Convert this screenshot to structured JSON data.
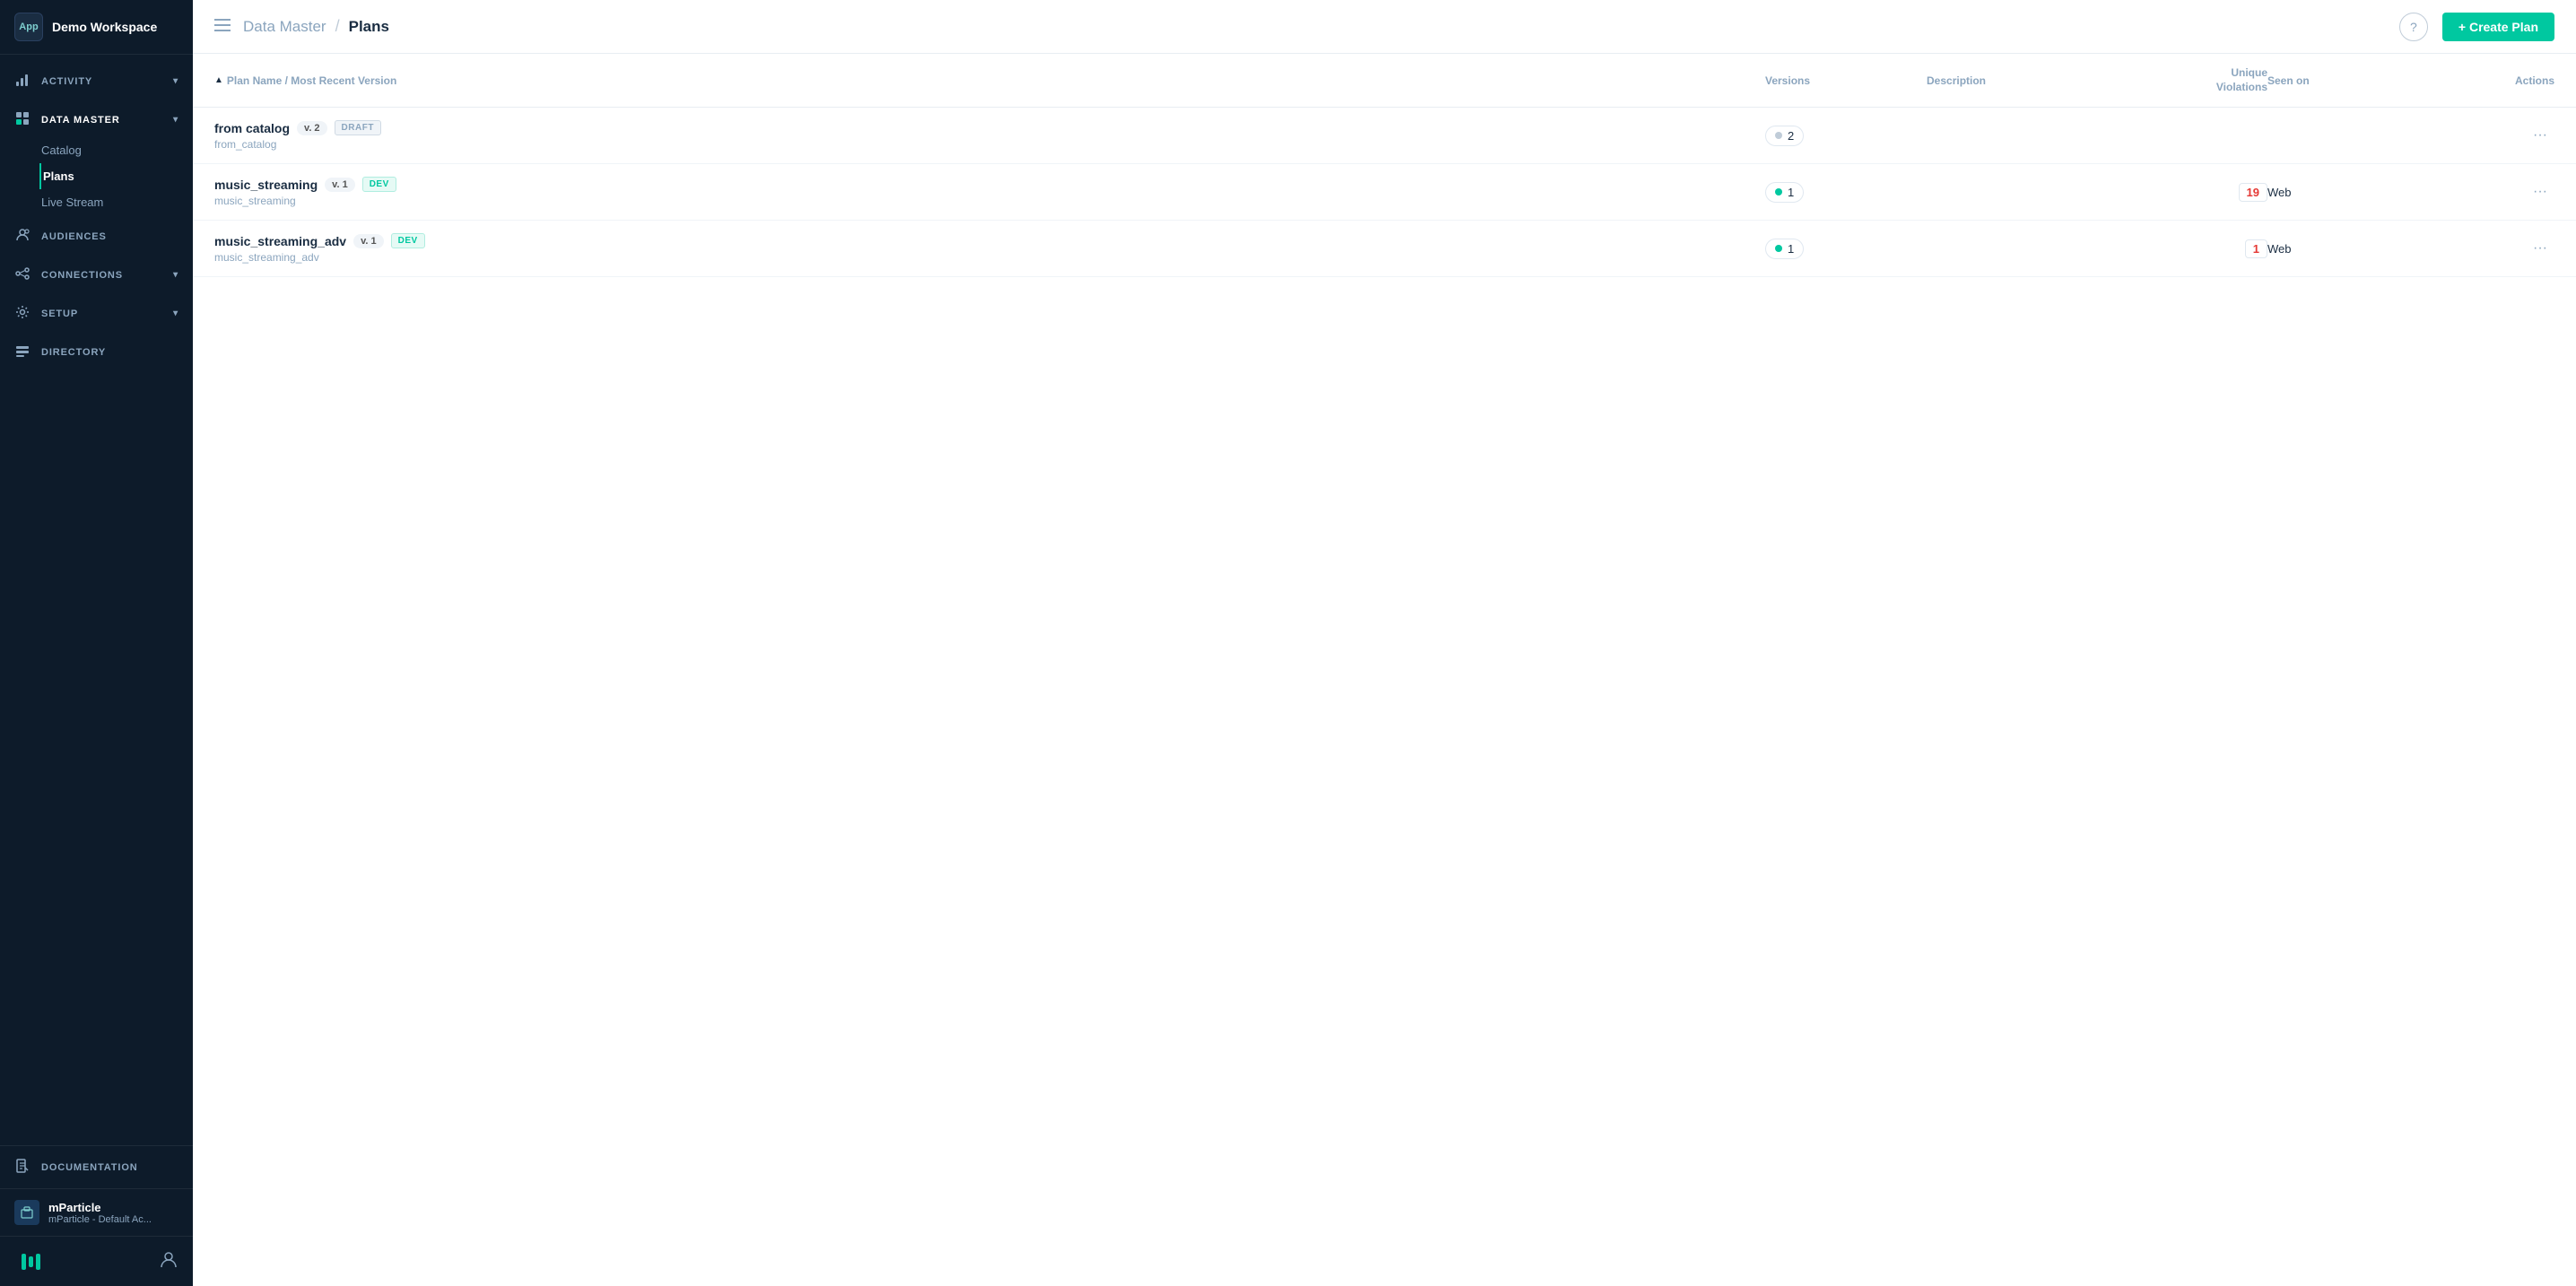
{
  "sidebar": {
    "workspace_name": "Demo Workspace",
    "app_label": "App",
    "nav_items": [
      {
        "id": "activity",
        "label": "ACTIVITY",
        "icon": "chart-icon",
        "expanded": false
      },
      {
        "id": "data-master",
        "label": "DATA MASTER",
        "icon": "table-icon",
        "expanded": true,
        "subitems": [
          {
            "id": "catalog",
            "label": "Catalog",
            "active": false
          },
          {
            "id": "plans",
            "label": "Plans",
            "active": true
          },
          {
            "id": "live-stream",
            "label": "Live Stream",
            "active": false
          }
        ]
      },
      {
        "id": "audiences",
        "label": "AUDIENCES",
        "icon": "audiences-icon",
        "expanded": false
      },
      {
        "id": "connections",
        "label": "CONNECTIONS",
        "icon": "connections-icon",
        "expanded": false
      },
      {
        "id": "setup",
        "label": "SETUP",
        "icon": "setup-icon",
        "expanded": false
      },
      {
        "id": "directory",
        "label": "DIRECTORY",
        "icon": "directory-icon",
        "expanded": false
      }
    ],
    "bottom_items": [
      {
        "id": "documentation",
        "label": "DOCUMENTATION",
        "icon": "doc-icon"
      }
    ],
    "org": {
      "name": "mParticle",
      "sub": "mParticle - Default Ac..."
    },
    "footer": {
      "logo_title": "mParticle Logo",
      "user_icon": "user-icon"
    }
  },
  "topbar": {
    "menu_toggle": "≡",
    "breadcrumb_parent": "Data Master",
    "breadcrumb_separator": "/",
    "breadcrumb_current": "Plans",
    "help_icon": "?",
    "create_plan_label": "+ Create Plan"
  },
  "table": {
    "headers": [
      {
        "id": "plan-name",
        "label": "Plan Name / Most Recent Version",
        "sortable": true
      },
      {
        "id": "versions",
        "label": "Versions",
        "sortable": false
      },
      {
        "id": "description",
        "label": "Description",
        "sortable": false
      },
      {
        "id": "unique-violations",
        "label": "Unique Violations",
        "sortable": false
      },
      {
        "id": "seen-on",
        "label": "Seen on",
        "sortable": false
      },
      {
        "id": "actions",
        "label": "Actions",
        "sortable": false
      }
    ],
    "rows": [
      {
        "id": "row-1",
        "plan_name": "from catalog",
        "plan_slug": "from_catalog",
        "version_num": "v. 2",
        "status": "DRAFT",
        "status_type": "draft",
        "version_count": "2",
        "dot_type": "grey",
        "description": "",
        "unique_violations": "",
        "violations_type": "none",
        "seen_on": ""
      },
      {
        "id": "row-2",
        "plan_name": "music_streaming",
        "plan_slug": "music_streaming",
        "version_num": "v. 1",
        "status": "DEV",
        "status_type": "dev",
        "version_count": "1",
        "dot_type": "green",
        "description": "",
        "unique_violations": "19",
        "violations_type": "red",
        "seen_on": "Web"
      },
      {
        "id": "row-3",
        "plan_name": "music_streaming_adv",
        "plan_slug": "music_streaming_adv",
        "version_num": "v. 1",
        "status": "DEV",
        "status_type": "dev",
        "version_count": "1",
        "dot_type": "green",
        "description": "",
        "unique_violations": "1",
        "violations_type": "red",
        "seen_on": "Web"
      }
    ]
  },
  "colors": {
    "accent": "#00c8a0",
    "sidebar_bg": "#0d1b2a",
    "text_primary": "#1a2d42",
    "text_muted": "#8ba5be"
  }
}
